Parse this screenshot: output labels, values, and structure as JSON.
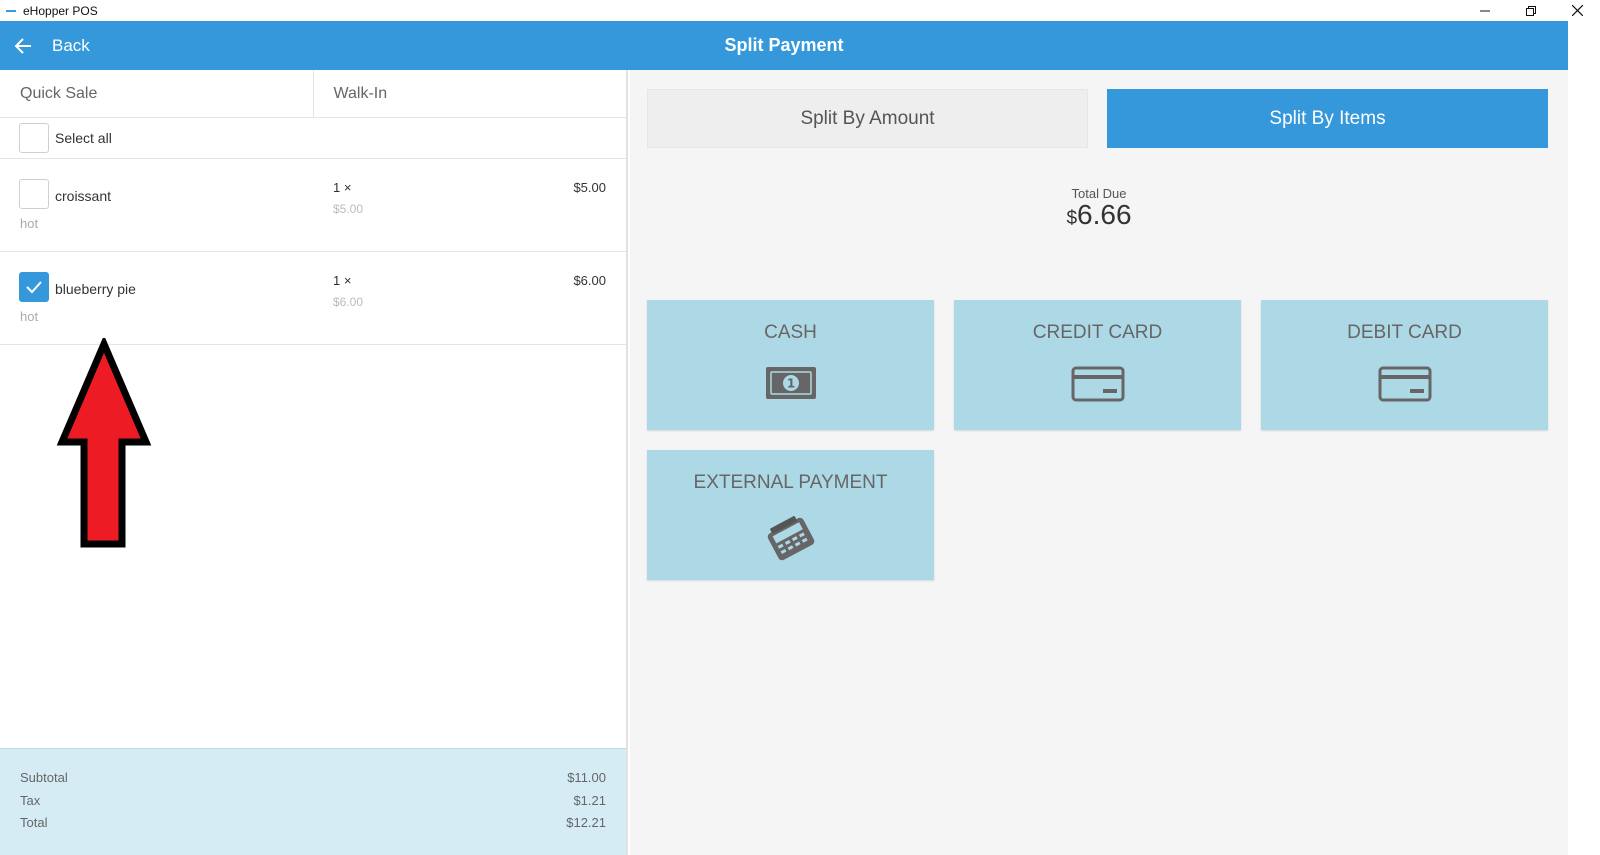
{
  "window": {
    "title": "eHopper POS"
  },
  "header": {
    "back_label": "Back",
    "title": "Split Payment"
  },
  "order": {
    "type": "Quick Sale",
    "customer": "Walk-In",
    "select_all_label": "Select all",
    "items": [
      {
        "name": "croissant",
        "modifier": "hot",
        "qty": "1 ×",
        "unit_price": "$5.00",
        "total": "$5.00",
        "checked": false
      },
      {
        "name": "blueberry pie",
        "modifier": "hot",
        "qty": "1 ×",
        "unit_price": "$6.00",
        "total": "$6.00",
        "checked": true
      }
    ],
    "summary": {
      "subtotal_label": "Subtotal",
      "subtotal": "$11.00",
      "tax_label": "Tax",
      "tax": "$1.21",
      "total_label": "Total",
      "total": "$12.21"
    }
  },
  "split": {
    "by_amount_label": "Split By Amount",
    "by_items_label": "Split By Items",
    "active": "items",
    "total_due_label": "Total Due",
    "currency": "$",
    "total_due": "6.66"
  },
  "payment_methods": [
    {
      "label": "CASH",
      "icon": "cash-icon"
    },
    {
      "label": "CREDIT CARD",
      "icon": "credit-card-icon"
    },
    {
      "label": "DEBIT CARD",
      "icon": "debit-card-icon"
    },
    {
      "label": "EXTERNAL PAYMENT",
      "icon": "card-terminal-icon"
    }
  ],
  "colors": {
    "primary": "#3498db",
    "tile": "#add8e6",
    "summary_bg": "#d5ecf5",
    "annotation_arrow": "#ed1c24"
  }
}
